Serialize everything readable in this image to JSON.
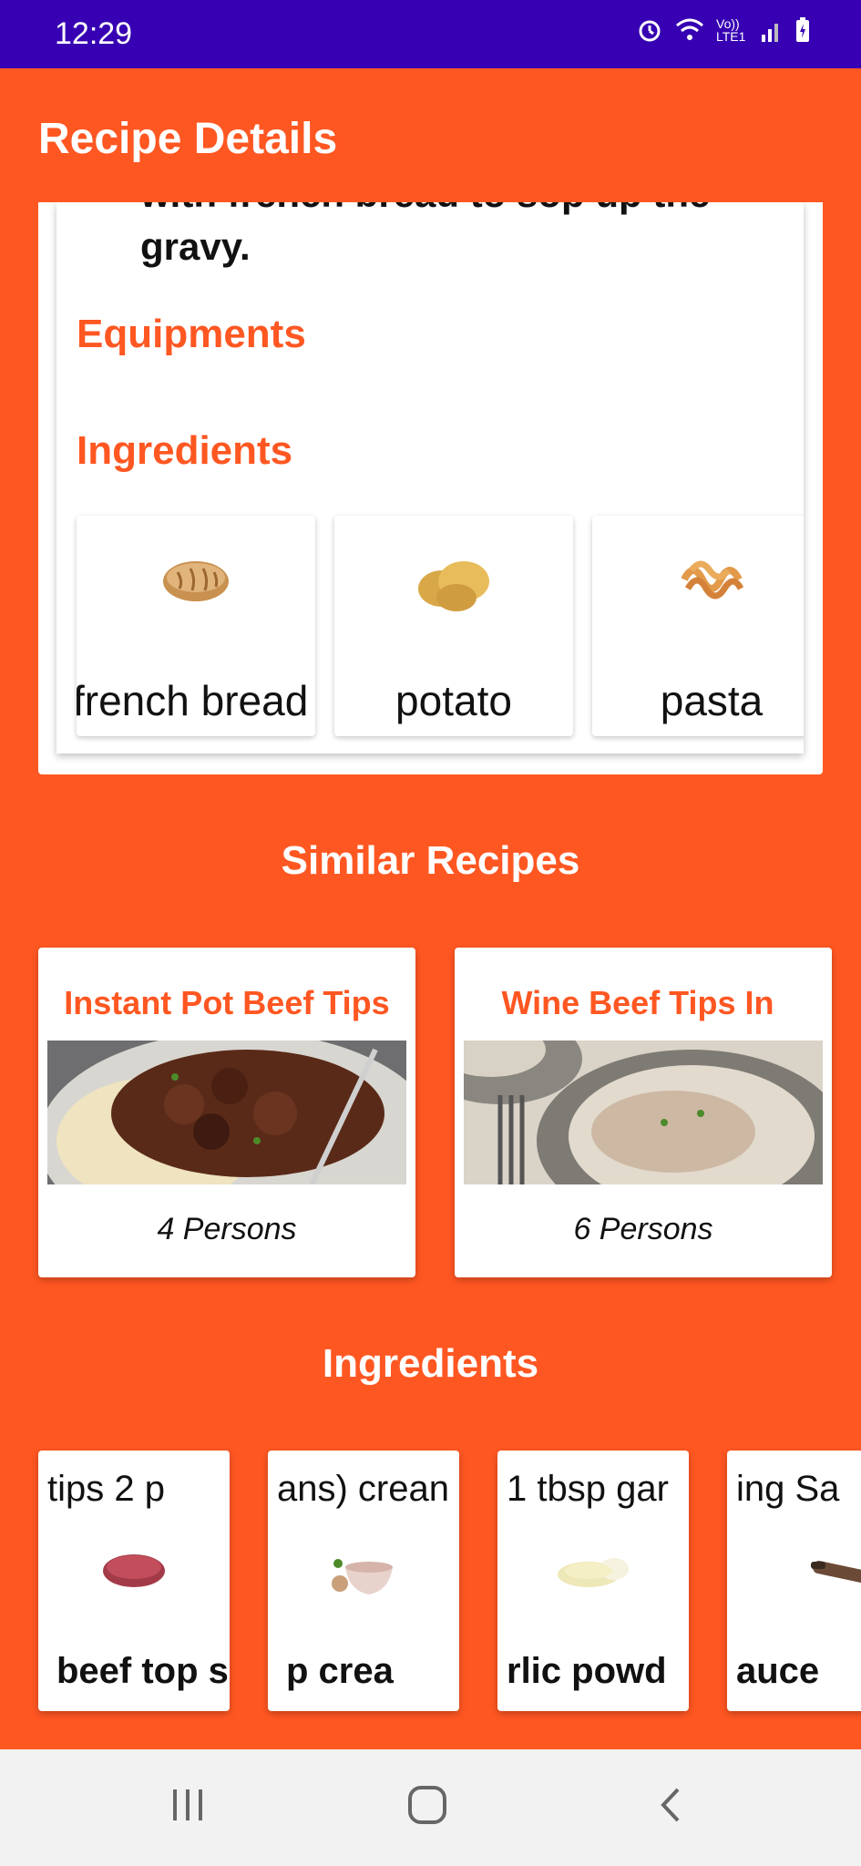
{
  "status_bar": {
    "time": "12:29",
    "icons": [
      "alarm-icon",
      "wifi-icon",
      "volte-icon",
      "signal-icon",
      "battery-icon"
    ],
    "volte_label": "Vo)) LTE1"
  },
  "app_bar": {
    "title": "Recipe Details"
  },
  "detail": {
    "step_text": "with french bread to sop up the\ngravy.",
    "equipments_heading": "Equipments",
    "ingredients_heading": "Ingredients",
    "ingredients": [
      {
        "name": "french bread",
        "icon": "bread-icon"
      },
      {
        "name": "potato",
        "icon": "potato-icon"
      },
      {
        "name": "pasta",
        "icon": "pasta-icon"
      }
    ]
  },
  "similar": {
    "heading": "Similar Recipes",
    "recipes": [
      {
        "title": "Instant Pot Beef Tips",
        "persons": "4 Persons"
      },
      {
        "title": "Wine Beef Tips       In",
        "persons": "6 Persons"
      }
    ]
  },
  "ingredients_section": {
    "heading": "Ingredients",
    "items": [
      {
        "amount": "tips      2 p",
        "name": "beef top s",
        "icon": "beef-icon"
      },
      {
        "amount": "ans) crean",
        "name": "p     crea",
        "icon": "cream-icon"
      },
      {
        "amount": "1 tbsp gar",
        "name": "rlic powd",
        "icon": "garlic-powder-icon"
      },
      {
        "amount": "ing Sa",
        "name": "auce",
        "icon": "sauce-icon"
      }
    ]
  },
  "nav": {
    "icons": [
      "recents-icon",
      "home-icon",
      "back-icon"
    ]
  },
  "colors": {
    "accent": "#FF5722",
    "status_bar": "#3700B3",
    "nav_bar": "#F2F2F2"
  }
}
